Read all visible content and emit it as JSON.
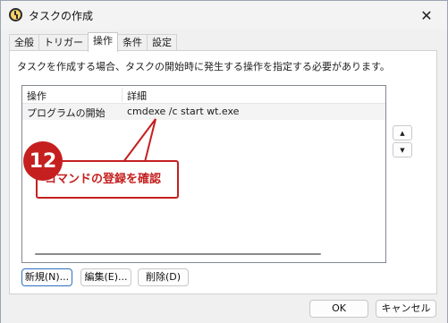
{
  "window": {
    "title": "タスクの作成",
    "close_glyph": "✕"
  },
  "tabs": [
    {
      "label": "全般"
    },
    {
      "label": "トリガー"
    },
    {
      "label": "操作"
    },
    {
      "label": "条件"
    },
    {
      "label": "設定"
    }
  ],
  "active_tab": "操作",
  "main": {
    "description": "タスクを作成する場合、タスクの開始時に発生する操作を指定する必要があります。",
    "list": {
      "columns": [
        "操作",
        "詳細"
      ],
      "rows": [
        {
          "action": "プログラムの開始",
          "detail": "cmdexe /c start wt.exe"
        }
      ]
    },
    "move_up_glyph": "▲",
    "move_down_glyph": "▼",
    "buttons": {
      "new": "新規(N)...",
      "edit": "編集(E)...",
      "delete": "削除(D)"
    }
  },
  "footer": {
    "ok": "OK",
    "cancel": "キャンセル"
  },
  "callout": {
    "number": "12",
    "text": "コマンドの登録を確認"
  },
  "colors": {
    "callout_red": "#c51f1f",
    "primary_border": "#2e6fc0"
  }
}
